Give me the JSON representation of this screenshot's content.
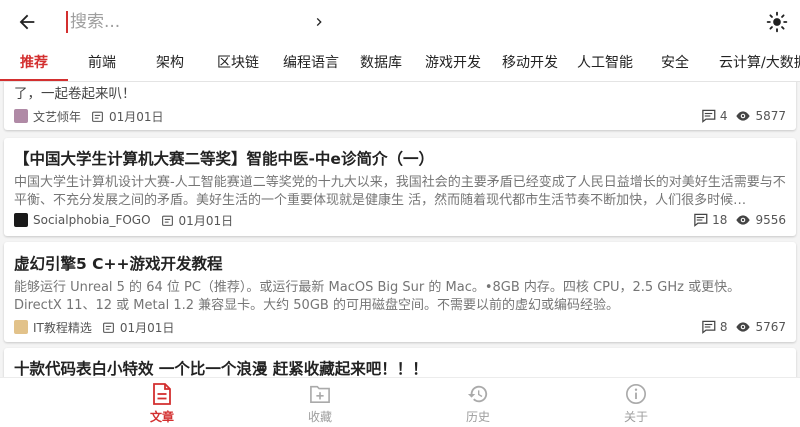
{
  "header": {
    "search_placeholder": "搜索..."
  },
  "tabs": [
    "推荐",
    "前端",
    "架构",
    "区块链",
    "编程语言",
    "数据库",
    "游戏开发",
    "移动开发",
    "人工智能",
    "安全",
    "云计算/大数据"
  ],
  "active_tab": "推荐",
  "articles": [
    {
      "title": "",
      "body": "了，一起卷起来叭！",
      "author": "文艺倾年",
      "date": "01月01日",
      "comments": "4",
      "views": "5877"
    },
    {
      "title": "【中国大学生计算机大赛二等奖】智能中医-中e诊简介（一）",
      "body": "中国大学生计算机设计大赛-人工智能赛道二等奖党的十九大以来，我国社会的主要矛盾已经变成了人民日益增长的对美好生活需要与不平衡、不充分发展之间的矛盾。美好生活的一个重要体现就是健康生 活，然而随着现代都市生活节奏不断加快，人们很多时候…",
      "author": "Socialphobia_FOGO",
      "date": "01月01日",
      "comments": "18",
      "views": "9556"
    },
    {
      "title": "虚幻引擎5 C++游戏开发教程",
      "body": "能够运行 Unreal 5 的 64 位 PC（推荐）。或运行最新 MacOS Big Sur 的 Mac。•8GB 内存。四核 CPU，2.5 GHz 或更快。DirectX 11、12 或 Metal 1.2 兼容显卡。大约 50GB 的可用磁盘空间。不需要以前的虚幻或编码经验。",
      "author": "IT教程精选",
      "date": "01月01日",
      "comments": "8",
      "views": "5767"
    },
    {
      "title": "十款代码表白小特效 一个比一个浪漫 赶紧收藏起来吧！！！",
      "body": "",
      "author": "",
      "date": "",
      "comments": "",
      "views": ""
    }
  ],
  "bottom_nav": [
    {
      "label": "文章",
      "icon": "article-icon",
      "active": true
    },
    {
      "label": "收藏",
      "icon": "bookmark-icon",
      "active": false
    },
    {
      "label": "历史",
      "icon": "history-icon",
      "active": false
    },
    {
      "label": "关于",
      "icon": "info-icon",
      "active": false
    }
  ],
  "colors": {
    "accent": "#d32f2f",
    "inactive": "#9e9e9e",
    "background": "#f4f4f4"
  }
}
